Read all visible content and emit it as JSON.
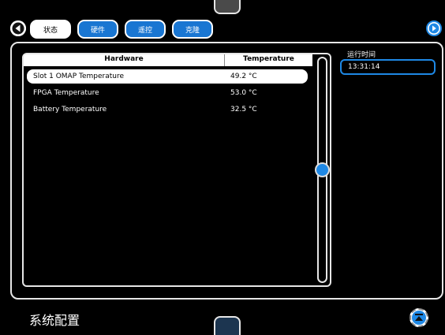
{
  "tabs": [
    {
      "label": "状态",
      "active": true
    },
    {
      "label": "硬件",
      "active": false
    },
    {
      "label": "遥控",
      "active": false
    },
    {
      "label": "克隆",
      "active": false
    }
  ],
  "table": {
    "headers": [
      "Hardware",
      "Temperature"
    ],
    "rows": [
      {
        "name": "Slot 1 OMAP Temperature",
        "temp": "49.2 °C",
        "selected": true
      },
      {
        "name": "FPGA Temperature",
        "temp": "53.0 °C",
        "selected": false
      },
      {
        "name": "Battery Temperature",
        "temp": "32.5 °C",
        "selected": false
      }
    ]
  },
  "runtime": {
    "label": "运行时间",
    "value": "13:31:14"
  },
  "page": {
    "title": "系统配置"
  },
  "icons": {
    "back": "chevron-left-icon",
    "forward": "chevron-right-icon",
    "scroll_top": "scroll-to-top-icon"
  },
  "colors": {
    "accent": "#1e88e5",
    "background": "#000000"
  }
}
